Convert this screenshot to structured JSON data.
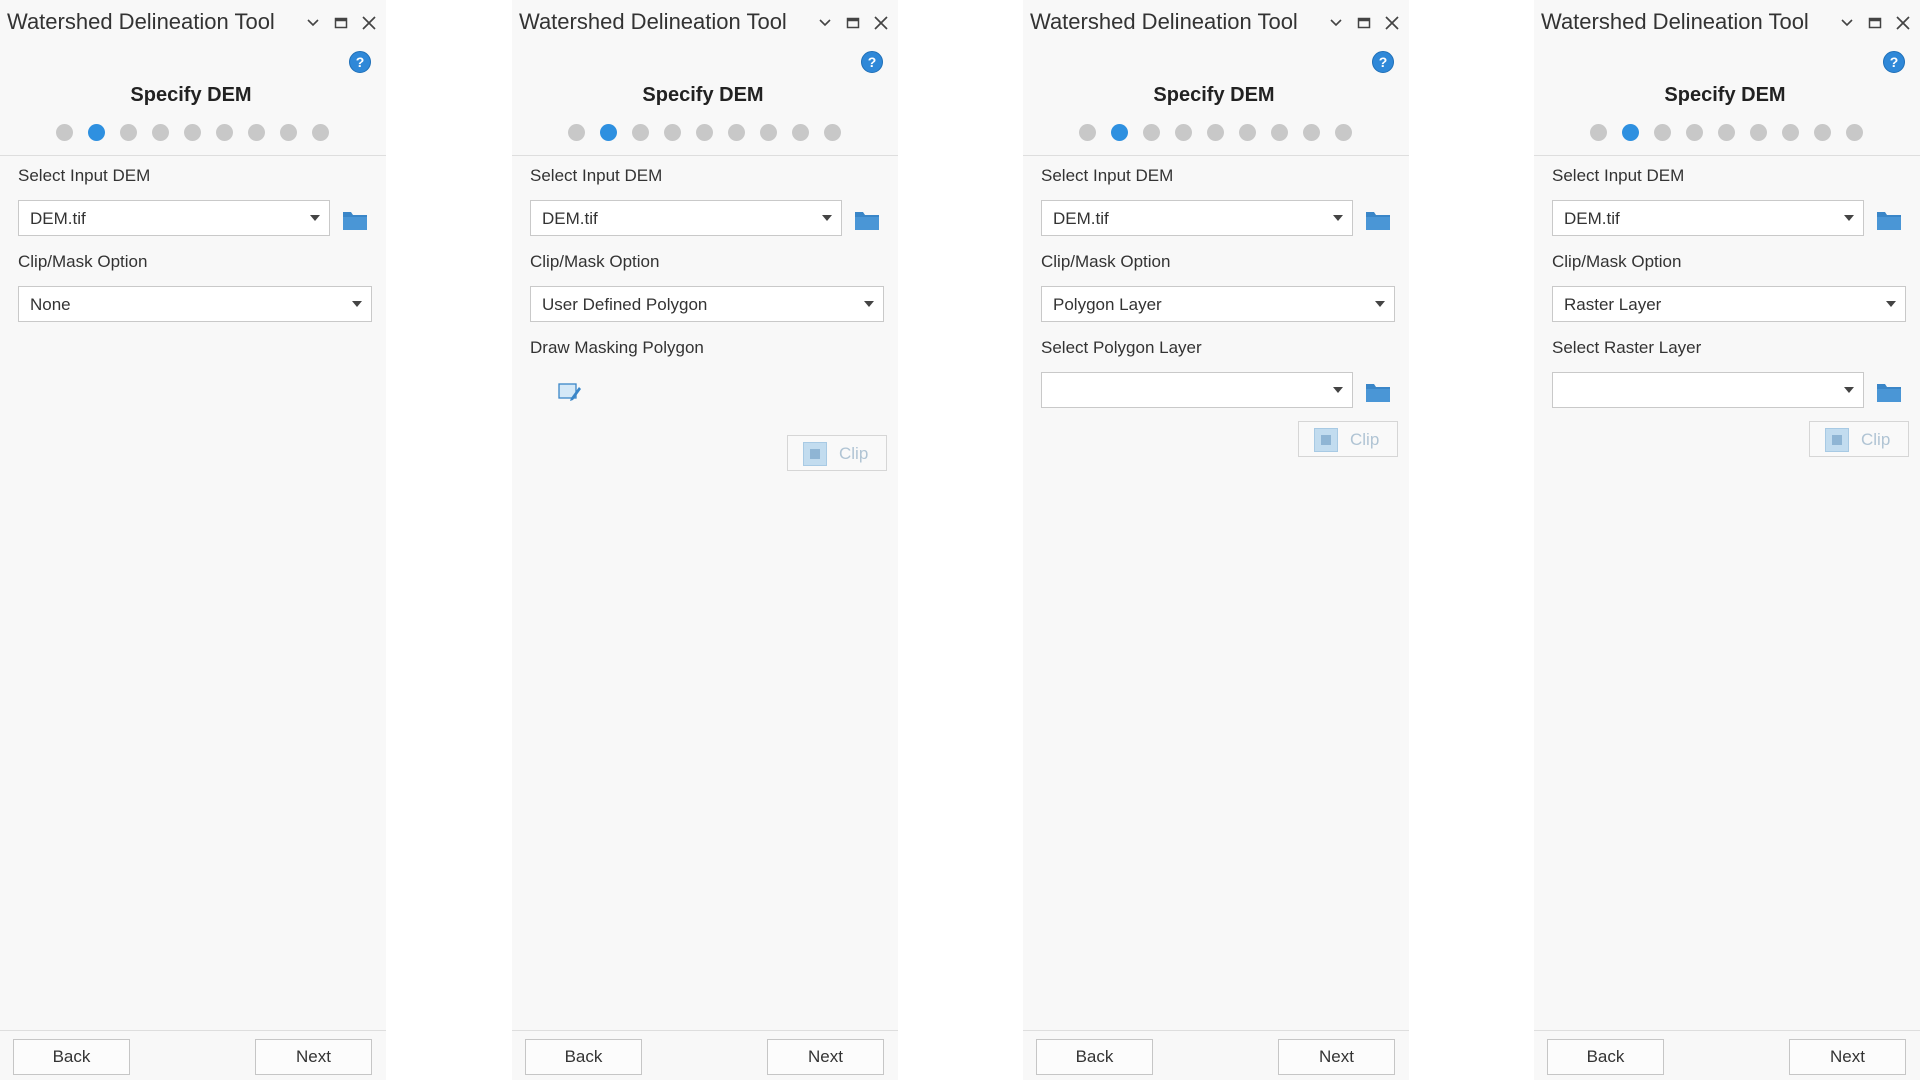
{
  "colors": {
    "accent": "#2e90e0",
    "dot_inactive": "#c8c8c8",
    "folder_icon": "#3a86c8",
    "pane_background": "#f8f8f8"
  },
  "panes": [
    {
      "title": "Watershed Delineation Tool",
      "help_label": "?",
      "step_title": "Specify DEM",
      "active_step": 2,
      "total_steps": 9,
      "input_dem_label": "Select Input DEM",
      "input_dem_value": "DEM.tif",
      "clip_label": "Clip/Mask Option",
      "clip_value": "None",
      "back_label": "Back",
      "next_label": "Next"
    },
    {
      "title": "Watershed Delineation Tool",
      "help_label": "?",
      "step_title": "Specify DEM",
      "active_step": 2,
      "total_steps": 9,
      "input_dem_label": "Select Input DEM",
      "input_dem_value": "DEM.tif",
      "clip_label": "Clip/Mask Option",
      "clip_value": "User Defined Polygon",
      "draw_label": "Draw Masking Polygon",
      "clip_button_label": "Clip",
      "back_label": "Back",
      "next_label": "Next"
    },
    {
      "title": "Watershed Delineation Tool",
      "help_label": "?",
      "step_title": "Specify DEM",
      "active_step": 2,
      "total_steps": 9,
      "input_dem_label": "Select Input DEM",
      "input_dem_value": "DEM.tif",
      "clip_label": "Clip/Mask Option",
      "clip_value": "Polygon Layer",
      "layer_label": "Select Polygon Layer",
      "layer_value": "",
      "clip_button_label": "Clip",
      "back_label": "Back",
      "next_label": "Next"
    },
    {
      "title": "Watershed Delineation Tool",
      "help_label": "?",
      "step_title": "Specify DEM",
      "active_step": 2,
      "total_steps": 9,
      "input_dem_label": "Select Input DEM",
      "input_dem_value": "DEM.tif",
      "clip_label": "Clip/Mask Option",
      "clip_value": "Raster Layer",
      "layer_label": "Select Raster Layer",
      "layer_value": "",
      "clip_button_label": "Clip",
      "back_label": "Back",
      "next_label": "Next"
    }
  ]
}
